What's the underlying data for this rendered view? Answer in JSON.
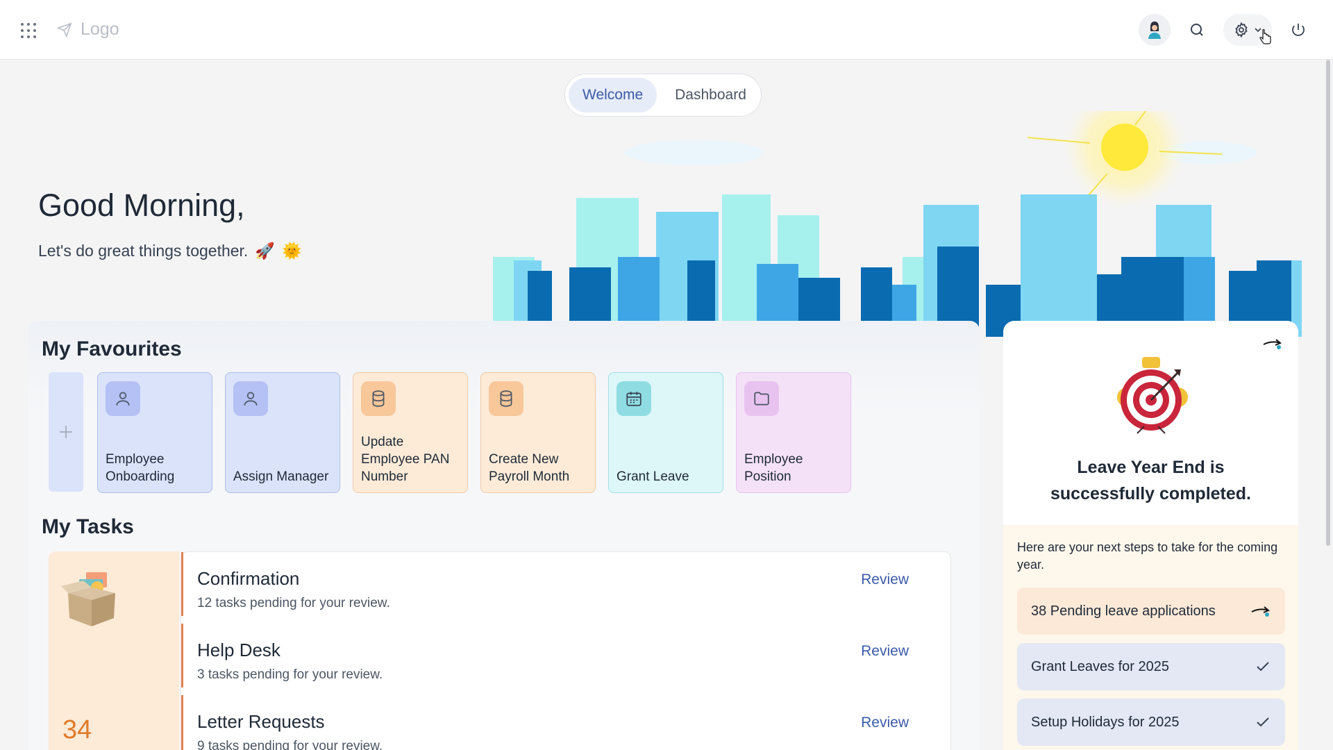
{
  "header": {
    "logo_text": "Logo",
    "icons": [
      "apps-grid-icon",
      "paper-plane-icon",
      "user-avatar",
      "search-icon",
      "gear-icon",
      "chevron-down-icon",
      "power-icon"
    ]
  },
  "tabs": [
    {
      "label": "Welcome",
      "active": true
    },
    {
      "label": "Dashboard",
      "active": false
    }
  ],
  "greeting": {
    "title": "Good Morning,",
    "subtitle": "Let's do great things together.",
    "emojis": [
      "🚀",
      "🌞"
    ]
  },
  "favourites": {
    "title": "My Favourites",
    "add_icon": "plus-icon",
    "items": [
      {
        "label": "Employee\nOnboarding",
        "icon": "user-icon",
        "bg": "#dbe3fb",
        "icon_bg": "#b5c0f4",
        "border": "#aebde8"
      },
      {
        "label": "Assign Manager",
        "icon": "user-icon",
        "bg": "#dbe3fb",
        "icon_bg": "#b5c0f4",
        "border": "#aebde8"
      },
      {
        "label": "Update\nEmployee PAN\nNumber",
        "icon": "database-icon",
        "bg": "#fdebd8",
        "icon_bg": "#f8c79a",
        "border": "#f1c9a5"
      },
      {
        "label": "Create New\nPayroll Month",
        "icon": "database-icon",
        "bg": "#fdebd8",
        "icon_bg": "#f8c79a",
        "border": "#f1c9a5"
      },
      {
        "label": "Grant Leave",
        "icon": "calendar-icon",
        "bg": "#ddf7f8",
        "icon_bg": "#8fdde2",
        "border": "#9fe0e3"
      },
      {
        "label": "Employee\nPosition",
        "icon": "folder-icon",
        "bg": "#f4e1f8",
        "icon_bg": "#e8c3f0",
        "border": "#e6c2ee"
      }
    ]
  },
  "tasks": {
    "title": "My Tasks",
    "count": "34",
    "items": [
      {
        "title": "Confirmation",
        "subtitle": "12 tasks pending for your review.",
        "action": "Review"
      },
      {
        "title": "Help Desk",
        "subtitle": "3 tasks pending for your review.",
        "action": "Review"
      },
      {
        "title": "Letter Requests",
        "subtitle": "9 tasks pending for your review.",
        "action": "Review"
      }
    ]
  },
  "leave_card": {
    "heading_line1": "Leave Year End is",
    "heading_line2": "successfully completed.",
    "note": "Here are your next steps to take for the coming year.",
    "steps": [
      {
        "label": "38 Pending leave applications",
        "status": "pending",
        "icon": "arrow-icon"
      },
      {
        "label": "Grant Leaves for 2025",
        "status": "done",
        "icon": "check-icon"
      },
      {
        "label": "Setup Holidays for 2025",
        "status": "done",
        "icon": "check-icon"
      }
    ]
  },
  "colors": {
    "accent": "#3b5aa8",
    "task_border": "#e2834f",
    "task_count": "#e07b2a"
  }
}
